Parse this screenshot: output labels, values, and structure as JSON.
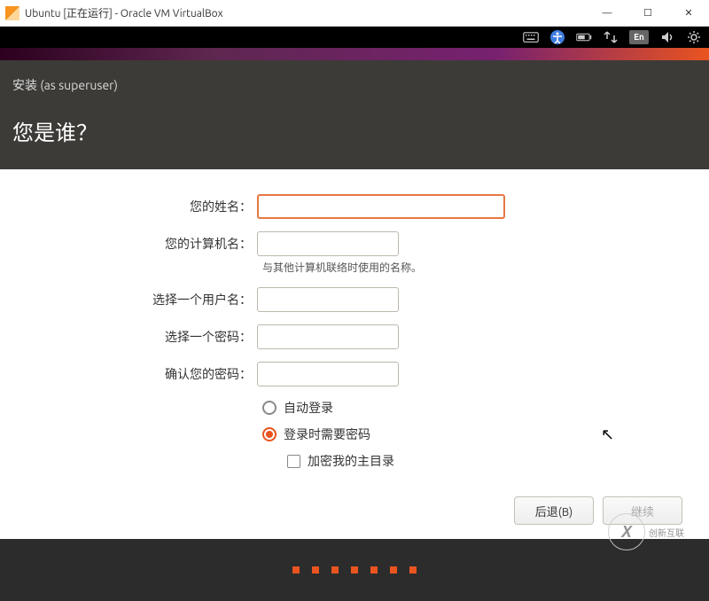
{
  "window": {
    "title": "Ubuntu [正在运行] - Oracle VM VirtualBox"
  },
  "statusbar_icons": [
    "keyboard",
    "accessibility",
    "battery",
    "network",
    "lang",
    "audio",
    "settings"
  ],
  "lang_indicator": "En",
  "installer": {
    "subtitle": "安装 (as superuser)",
    "title": "您是谁？"
  },
  "form": {
    "name_label": "您的姓名：",
    "hostname_label": "您的计算机名：",
    "hostname_hint": "与其他计算机联络时使用的名称。",
    "username_label": "选择一个用户名：",
    "password_label": "选择一个密码：",
    "confirm_label": "确认您的密码：",
    "name_value": "",
    "hostname_value": "",
    "username_value": "",
    "password_value": "",
    "confirm_value": "",
    "auto_login_label": "自动登录",
    "require_password_label": "登录时需要密码",
    "encrypt_home_label": "加密我的主目录",
    "login_mode": "require_password",
    "encrypt_home_checked": false
  },
  "buttons": {
    "back": "后退(B)",
    "continue": "继续"
  },
  "watermark": {
    "text": "创新互联"
  }
}
